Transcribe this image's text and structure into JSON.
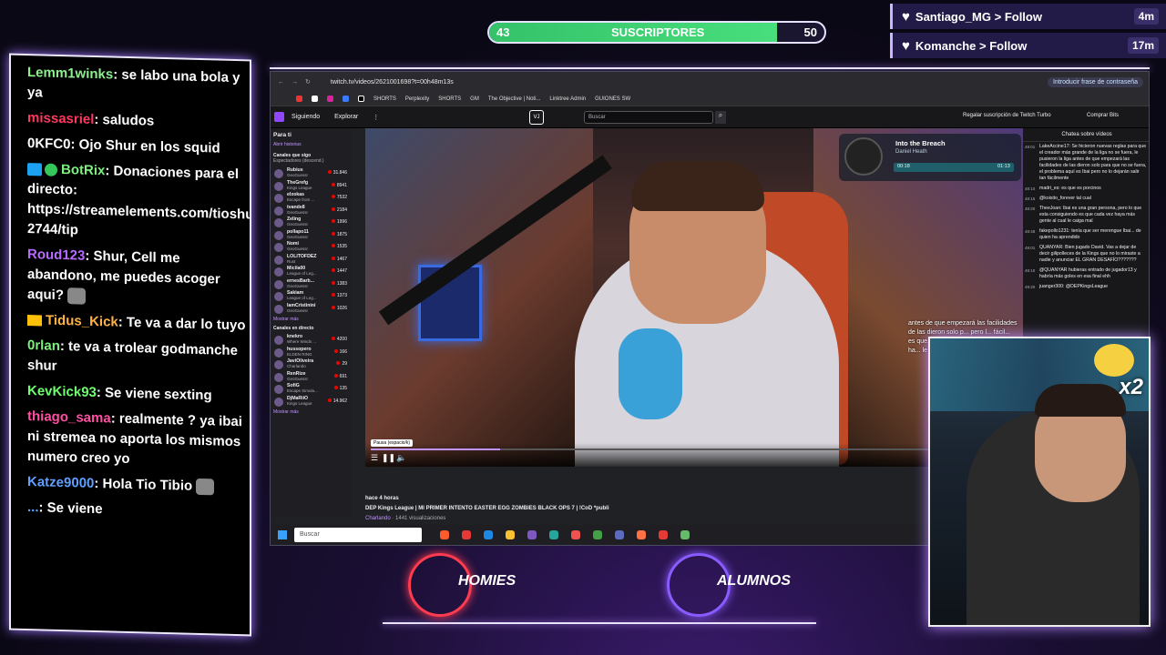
{
  "subs": {
    "current": "43",
    "label": "SUSCRIPTORES",
    "goal": "50",
    "fraction": 0.86
  },
  "follows": [
    {
      "user": "Santiago_MG",
      "action": "> Follow",
      "ago": "4m"
    },
    {
      "user": "Komanche",
      "action": "> Follow",
      "ago": "17m"
    }
  ],
  "chat": [
    {
      "user": "Lemm1winks",
      "text": ": se labo una bola y ya"
    },
    {
      "user": "missasriel",
      "text": ": saludos"
    },
    {
      "user": "0KFC0",
      "text": ": Ojo Shur en los squid"
    },
    {
      "user": "BotRix",
      "text": ": Donaciones para el directo: https://streamelements.com/tioshur-2744/tip"
    },
    {
      "user": "Roud123",
      "text": ": Shur, Cell me abandono, me puedes acoger aqui?"
    },
    {
      "user": "Tidus_Kick",
      "text": ": Te va a dar lo tuyo"
    },
    {
      "user": "0rlan",
      "text": ": te va a trolear godmanche shur"
    },
    {
      "user": "KevKick93",
      "text": ": Se viene sexting"
    },
    {
      "user": "thiago_sama",
      "text": ": realmente ? ya ibai ni stremea no aporta los mismos numero creo yo"
    },
    {
      "user": "Katze9000",
      "text": ": Hola Tio Tibio"
    },
    {
      "user": "...",
      "text": ": Se viene"
    }
  ],
  "browser": {
    "url": "twitch.tv/videos/2621001698?t=00h48m13s",
    "password_hint": "Introducir frase de contraseña",
    "bookmarks": [
      "SHORTS",
      "Perplexity",
      "SHORTS",
      "GM",
      "The Objective | Noti...",
      "Linktree Admin",
      "GUIONES SW"
    ],
    "nav": {
      "following": "Siguiendo",
      "browse": "Explorar",
      "search_placeholder": "Buscar",
      "gift": "Regalar suscripción de Twitch Turbo",
      "bits": "Comprar Bits"
    },
    "sidebar": {
      "for_you": "Para ti",
      "open_history": "Abrir historias",
      "followed_header": "Canales que sigo",
      "followed_sub": "Espectadores (descend.)",
      "channels": [
        {
          "name": "Rubius",
          "game": "GeoGuessr",
          "viewers": "31.846"
        },
        {
          "name": "TheGrefg",
          "game": "Kings League",
          "viewers": "8941"
        },
        {
          "name": "elxokas",
          "game": "Escape from ...",
          "viewers": "7532"
        },
        {
          "name": "tvande8",
          "game": "GeoGuessr",
          "viewers": "2184"
        },
        {
          "name": "Zeling",
          "game": "GeoGuessr",
          "viewers": "1996"
        },
        {
          "name": "pollapo11",
          "game": "GeoGuessr",
          "viewers": "1875"
        },
        {
          "name": "Nomi",
          "game": "GeoGuessr",
          "viewers": "1535"
        },
        {
          "name": "LOLITOFDEZ",
          "game": "Rust",
          "viewers": "1467"
        },
        {
          "name": "Micila00",
          "game": "League of Leg...",
          "viewers": "1447"
        },
        {
          "name": "ernesBarb...",
          "game": "GeoGuessr",
          "viewers": "1383"
        },
        {
          "name": "Sakiam",
          "game": "League of Leg...",
          "viewers": "1373"
        },
        {
          "name": "IamCristinini",
          "game": "GeoGuessr",
          "viewers": "1026"
        }
      ],
      "show_more": "Mostrar más",
      "live_header": "Canales en directo",
      "live_channels": [
        {
          "name": "knekro",
          "game": "Where Winds ...",
          "viewers": "4200"
        },
        {
          "name": "hussopero",
          "game": "ELDEN RING",
          "viewers": "166"
        },
        {
          "name": "JaviOliveira",
          "game": "Charlando",
          "viewers": "29"
        },
        {
          "name": "RenRize",
          "game": "GeoGuessr",
          "viewers": "691"
        },
        {
          "name": "SofiG",
          "game": "Escape Simula...",
          "viewers": "135"
        },
        {
          "name": "DjMaRiiO",
          "game": "Kings League",
          "viewers": "14.962"
        }
      ],
      "show_more_2": "Mostrar más"
    },
    "music": {
      "title": "Into the Breach",
      "artist": "Daniel Heath",
      "elapsed": "00:18",
      "total": "01:13"
    },
    "overlay_chat": "antes de que empezará las facilidades de las dieron solo p... pero l... fácil... es que... ibai e... pero l... consig... vez ha... le cai...",
    "tooltip": "Pausa (espacio/k)",
    "video_info": {
      "ago": "hace 4 horas",
      "title": "DEP Kings League | MI PRIMER INTENTO EASTER EGG ZOMBIES BLACK OPS 7 | !CoD *publi",
      "category": "Charlando",
      "views": "1441 visualizaciones"
    },
    "video_chat": {
      "header": "Chatea sobre vídeos",
      "lines": [
        {
          "ts": "48:01",
          "text": "LakeAccine17: Se hicieron nuevas reglas para que el creador más grande de la liga no se fuera, le pusieron la liga antes de que empezará las facilidades de las dieron solo para que no se fuera, el problema aquí es Ibai pero no lo dejarán salir tan fácilmente"
        },
        {
          "ts": "48:10",
          "text": "madri_es: es que es porcinos"
        },
        {
          "ts": "48:15",
          "text": "@koisito_forever tal cual"
        },
        {
          "ts": "48:20",
          "text": "TheeJoan: Ibai es una gran persona, pero lo que esta consiguiendo es que cada vez haya más gente al cual le caiga mal"
        },
        {
          "ts": "48:48",
          "text": "fakepollo1231: tenía que ser merengue Ibai... de quien ha aprendido"
        },
        {
          "ts": "49:01",
          "text": "QUANYAR: Bien jugado David. Vas a dejar de decir gilipolleces de la Kings que no lo miraste a nadie y anunciar EL GRAN DESAFÍO???????"
        },
        {
          "ts": "49:10",
          "text": "@QUANYAR hubieras entrado de jugador13 y habría más goles en esa final ehh"
        },
        {
          "ts": "49:20",
          "text": "juanger300: @DEPKingsLeague"
        }
      ]
    },
    "taskbar_search": "Buscar"
  },
  "logos": [
    {
      "word": "HOMIES",
      "color": "#ff3b4f"
    },
    {
      "word": "ALUMNOS",
      "color": "#8a5bff"
    }
  ],
  "cam": {
    "multiplier": "x2"
  }
}
